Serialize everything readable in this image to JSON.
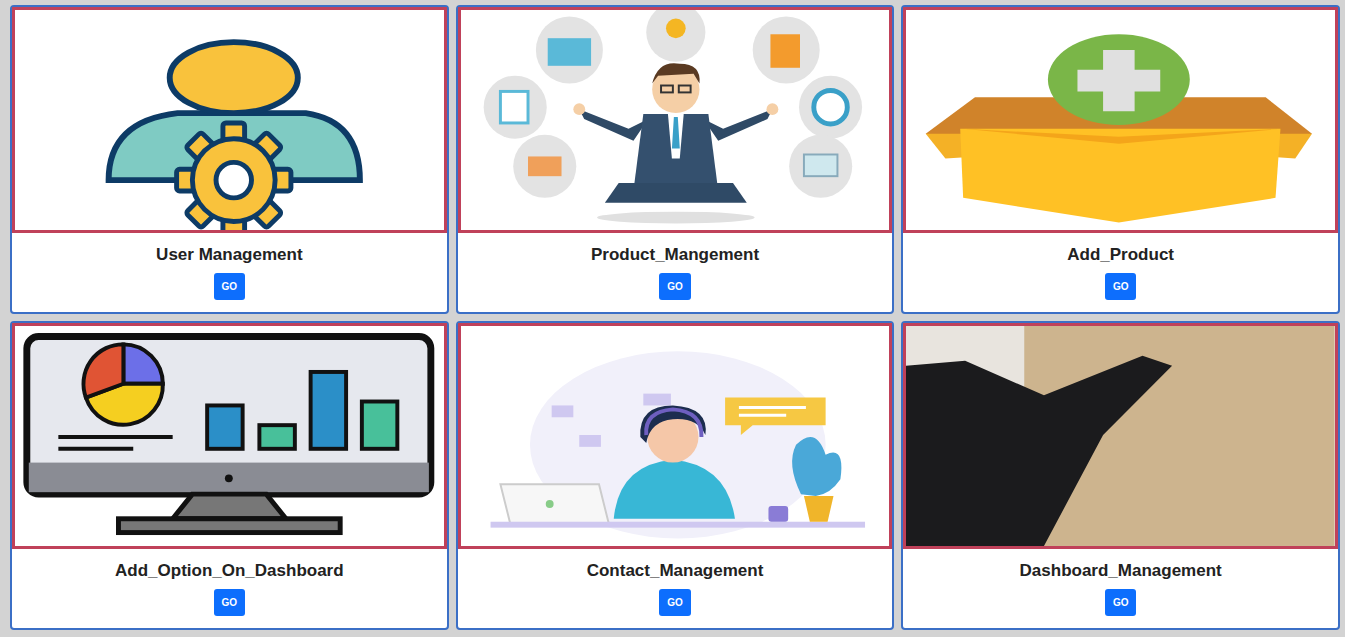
{
  "cards": [
    {
      "title": "User Management",
      "button": "GO",
      "kind": "user"
    },
    {
      "title": "Product_Mangement",
      "button": "GO",
      "kind": "business"
    },
    {
      "title": "Add_Product",
      "button": "GO",
      "kind": "box"
    },
    {
      "title": "Add_Option_On_Dashboard",
      "button": "GO",
      "kind": "chart"
    },
    {
      "title": "Contact_Management",
      "button": "GO",
      "kind": "support"
    },
    {
      "title": "Dashboard_Management",
      "button": "GO",
      "kind": "photo"
    }
  ]
}
